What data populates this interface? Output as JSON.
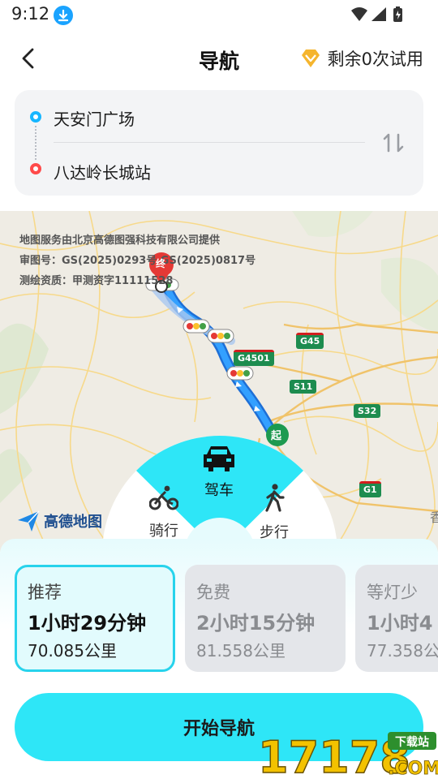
{
  "status_bar": {
    "time": "9:12",
    "icons": [
      "download-icon",
      "wifi-icon",
      "signal-icon",
      "battery-charging-icon"
    ]
  },
  "header": {
    "title": "导航",
    "trial_text": "剩余0次试用",
    "back_icon": "chevron-left-icon",
    "trial_icon": "vip-diamond-icon"
  },
  "route": {
    "start": "天安门广场",
    "end": "八达岭长城站",
    "swap_icon": "swap-vertical-icon"
  },
  "map": {
    "credit_line1": "地图服务由北京高德图强科技有限公司提供",
    "credit_line2": "审图号：GS(2025)0293号 GS(2025)0817号",
    "credit_line3": "测绘资质：甲测资字11111528",
    "logo_text": "高德地图",
    "road_badges": [
      "G45",
      "G4501",
      "S11",
      "S32",
      "G1"
    ],
    "start_marker": "起",
    "end_marker": "终",
    "side_char": "香"
  },
  "modes": {
    "drive": "驾车",
    "bike": "骑行",
    "walk": "步行",
    "selected": "驾车"
  },
  "route_options": [
    {
      "tag": "推荐",
      "time": "1小时29分钟",
      "distance": "70.085公里",
      "active": true
    },
    {
      "tag": "免费",
      "time": "2小时15分钟",
      "distance": "81.558公里",
      "active": false
    },
    {
      "tag": "等灯少",
      "time": "1小时4",
      "distance": "77.358公",
      "active": false
    }
  ],
  "start_button": "开始导航",
  "watermark": {
    "digits": "17178",
    "badge": "下载站",
    "suffix": ".COM"
  },
  "colors": {
    "accent": "#2ee6f7",
    "accent_border": "#27d3ec",
    "route_line": "#2f8cf5",
    "start_dot": "#17b6ff",
    "end_dot": "#ff4a4a",
    "vip": "#f5b52e"
  }
}
